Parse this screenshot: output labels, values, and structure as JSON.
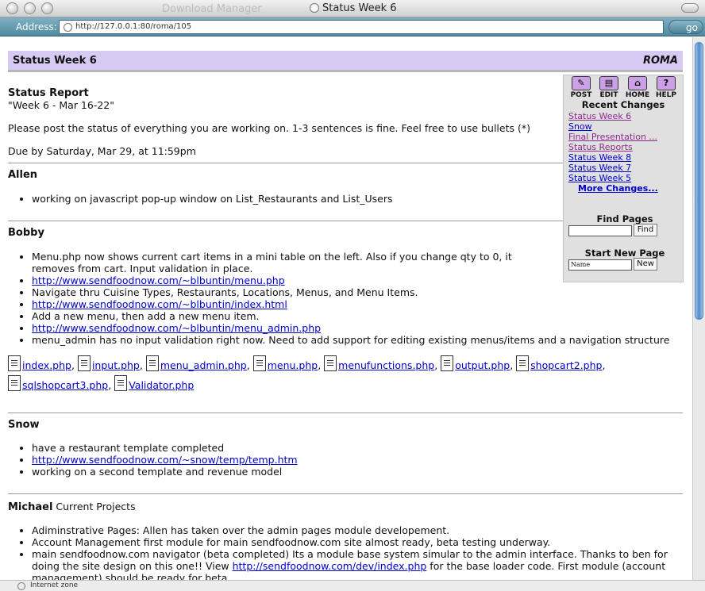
{
  "window": {
    "ghost_title": "Download Manager",
    "title": "Status Week 6"
  },
  "address_bar": {
    "label": "Address:",
    "url": "http://127.0.0.1:80/roma/105",
    "go_label": "go"
  },
  "status_bar": {
    "text": "Internet zone"
  },
  "header": {
    "title": "Status Week 6",
    "site_name": "ROMA"
  },
  "intro": {
    "heading": "Status Report",
    "subtitle": "\"Week 6 - Mar 16-22\"",
    "instructions": "Please post the status of everything you are working on. 1-3 sentences is fine. Feel free to use bullets (*)",
    "due": "Due by Saturday, Mar 29, at 11:59pm"
  },
  "sections": {
    "allen": {
      "name": "Allen",
      "items": [
        "working on javascript pop-up window on List_Restaurants and List_Users"
      ]
    },
    "bobby": {
      "name": "Bobby",
      "items": [
        "Menu.php now shows current cart items in a mini table on the left. Also if you change qty to 0, it removes from cart. Input validation in place.",
        "http://www.sendfoodnow.com/~blbuntin/menu.php",
        "Navigate thru Cuisine Types, Restaurants, Locations, Menus, and Menu Items.",
        "http://www.sendfoodnow.com/~blbuntin/index.html",
        "Add a new menu, then add a new menu item.",
        "http://www.sendfoodnow.com/~blbuntin/menu_admin.php",
        "menu_admin has no input validation right now. Need to add support for editing existing menus/items and a navigation structure"
      ],
      "files": [
        "index.php",
        "input.php",
        "menu_admin.php",
        "menu.php",
        "menufunctions.php",
        "output.php",
        "shopcart2.php",
        "sqlshopcart3.php",
        "Validator.php"
      ]
    },
    "snow": {
      "name": "Snow",
      "items": [
        "have a restaurant template completed",
        "http://www.sendfoodnow.com/~snow/temp/temp.htm",
        "working on a second template and revenue model"
      ]
    },
    "michael": {
      "name": "Michael",
      "suffix": "Current Projects",
      "items": [
        "Adiminstrative Pages: Allen has taken over the admin pages module developement.",
        "Account Management first module for main sendfoodnow.com site almost ready, beta testing underway.",
        "main sendfoodnow.com navigator (beta completed) Its a module base system simular to the admin interface. Thanks to ben for doing the site design on this one!! View",
        "http://sendfoodnow.com/dev/index.php",
        "for the base loader code. First module (account management) should be ready for beta."
      ]
    }
  },
  "sidebar": {
    "tools": [
      {
        "label": "POST",
        "icon": "post-icon"
      },
      {
        "label": "EDIT",
        "icon": "edit-icon"
      },
      {
        "label": "HOME",
        "icon": "home-icon"
      },
      {
        "label": "HELP",
        "icon": "help-icon"
      }
    ],
    "recent_title": "Recent Changes",
    "recent": [
      "Status Week 6",
      "Snow",
      "Final Presentation ...",
      "Status Reports",
      "Status Week 8",
      "Status Week 7",
      "Status Week 5"
    ],
    "more": "More Changes...",
    "find_title": "Find Pages",
    "find_button": "Find",
    "new_title": "Start New Page",
    "new_placeholder": "Name",
    "new_button": "New"
  },
  "colors": {
    "header_bg": "#d6c9f2",
    "link": "#0000cc",
    "visited_link": "#8a2a8a",
    "address_bar": "#4f8aa0"
  }
}
